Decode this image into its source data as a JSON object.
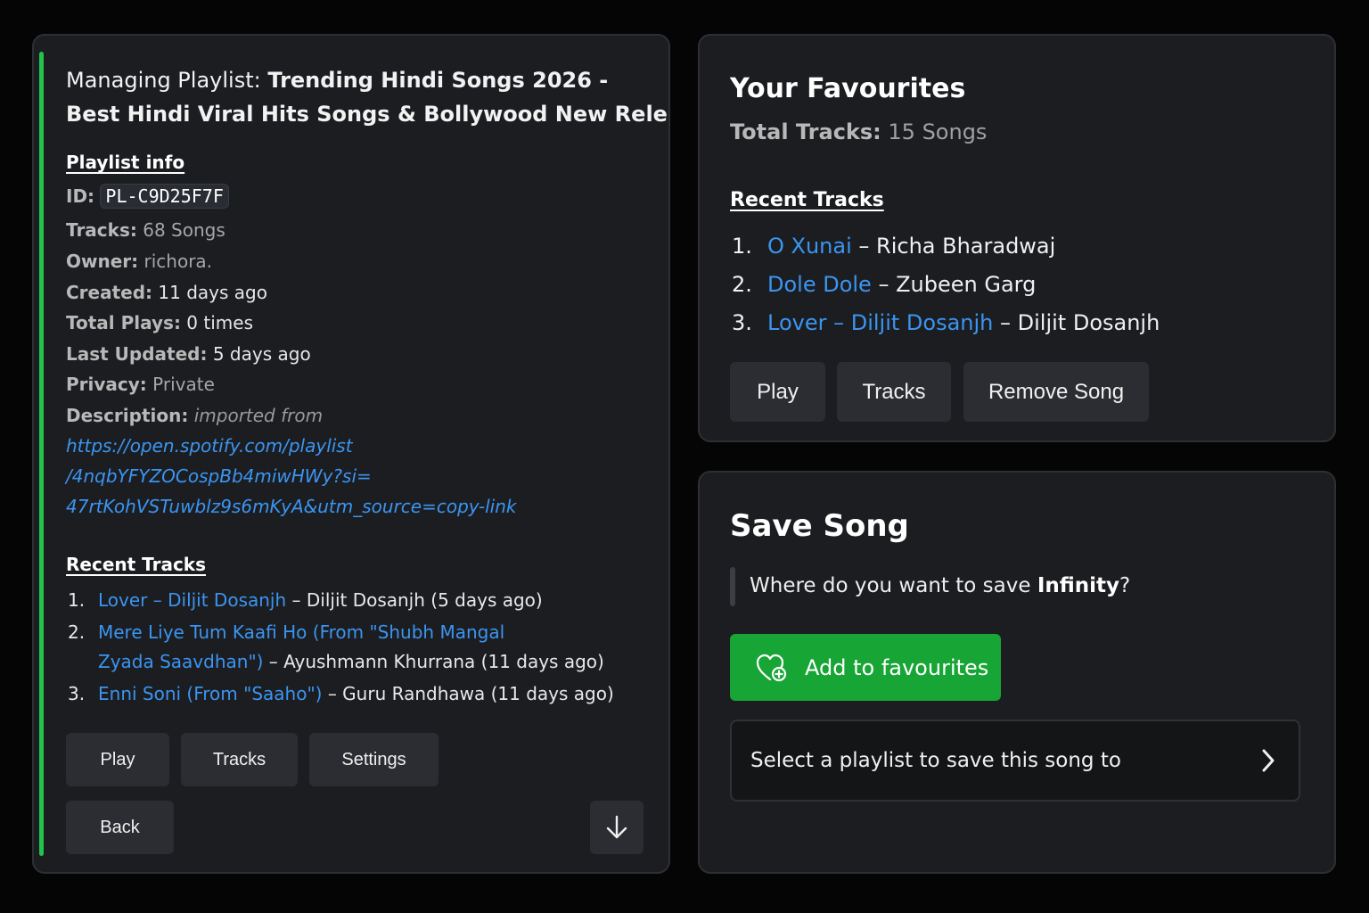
{
  "playlist": {
    "title_prefix": "Managing Playlist: ",
    "title_line1": "Trending Hindi Songs 2026 -",
    "title_line2": "Best Hindi Viral Hits Songs & Bollywood New Release",
    "info_header": "Playlist info",
    "id_label": "ID:",
    "id_value": "PL-C9D25F7F",
    "tracks_label": "Tracks:",
    "tracks_value": "68 Songs",
    "owner_label": "Owner:",
    "owner_value": "richora.",
    "created_label": "Created:",
    "created_value": "11 days ago",
    "plays_label": "Total Plays:",
    "plays_value": "0 times",
    "updated_label": "Last Updated:",
    "updated_value": "5 days ago",
    "privacy_label": "Privacy:",
    "privacy_value": "Private",
    "description_label": "Description:",
    "description_value": "imported from",
    "description_link_1": "https://open.spotify.com/playlist",
    "description_link_2": "/4nqbYFYZOCospBb4miwHWy?si=",
    "description_link_3": "47rtKohVSTuwblz9s6mKyA&utm_source=copy-link",
    "recent_header": "Recent Tracks",
    "recent_tracks": [
      {
        "num": "1.",
        "title": "Lover – Diljit Dosanjh",
        "rest": " – Diljit Dosanjh (5 days ago)"
      },
      {
        "num": "2.",
        "title_line1": "Mere Liye Tum Kaafi Ho (From \"Shubh Mangal",
        "title_line2": "Zyada Saavdhan\")",
        "rest": " – Ayushmann Khurrana (11 days ago)"
      },
      {
        "num": "3.",
        "title": "Enni Soni (From \"Saaho\")",
        "rest": " – Guru Randhawa (11 days ago)"
      }
    ],
    "buttons": {
      "play": "Play",
      "tracks": "Tracks",
      "settings": "Settings",
      "back": "Back"
    }
  },
  "favourites": {
    "title": "Your Favourites",
    "total_label": "Total Tracks:",
    "total_value": " 15 Songs",
    "recent_header": "Recent Tracks",
    "tracks": [
      {
        "num": "1.",
        "title": "O Xunai",
        "artist": " – Richa Bharadwaj"
      },
      {
        "num": "2.",
        "title": "Dole Dole",
        "artist": " – Zubeen Garg"
      },
      {
        "num": "3.",
        "title": "Lover – Diljit Dosanjh",
        "artist": " – Diljit Dosanjh"
      }
    ],
    "buttons": {
      "play": "Play",
      "tracks": "Tracks",
      "remove": "Remove Song"
    }
  },
  "save_song": {
    "title": "Save Song",
    "question_prefix": "Where do you want to save ",
    "song_name": "Infinity",
    "question_suffix": "?",
    "add_fav_label": "Add to favourites",
    "select_placeholder": "Select a playlist to save this song to"
  },
  "icons": {
    "down_arrow": "arrow-down-icon",
    "heart_add": "heart-plus-icon",
    "chevron": "chevron-right-icon"
  },
  "colors": {
    "accent_green": "#22c34a",
    "button_green": "#17a535",
    "link_blue": "#3b95f0",
    "card_bg": "#1c1d21",
    "page_bg": "#050505"
  }
}
